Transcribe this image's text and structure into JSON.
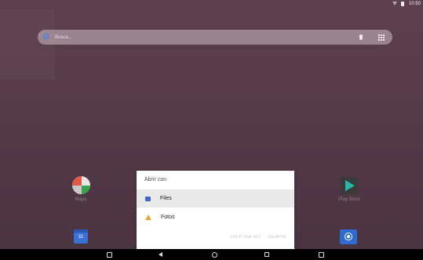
{
  "status_bar": {
    "time": "10:50"
  },
  "search": {
    "logo": "G",
    "placeholder": "Busca..."
  },
  "home": {
    "maps_label": "Maps",
    "play_label": "Play Store",
    "calendar_day": "31"
  },
  "dialog": {
    "title": "Abrir con",
    "options": [
      {
        "label": "Files",
        "icon": "files-icon",
        "selected": true
      },
      {
        "label": "Fotos",
        "icon": "photos-icon",
        "selected": false
      }
    ],
    "actions": {
      "once": "SOLO UNA VEZ",
      "always": "SIEMPRE"
    }
  },
  "nav": {
    "buttons": [
      "volume-down",
      "back",
      "home",
      "recents",
      "volume-up"
    ]
  }
}
